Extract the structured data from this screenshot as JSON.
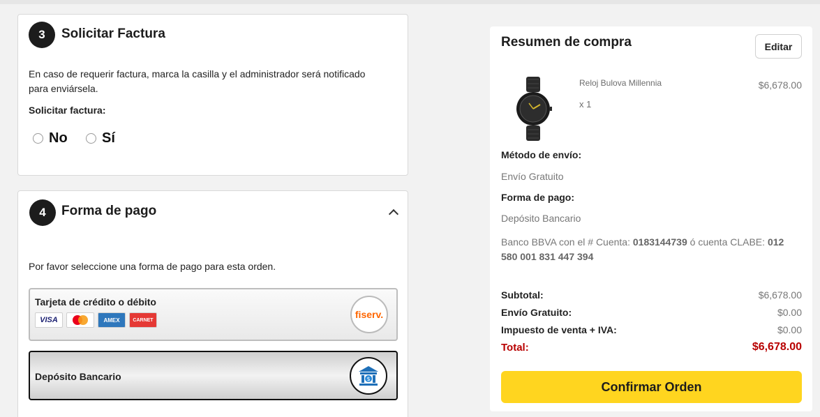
{
  "invoice": {
    "step": "3",
    "title": "Solicitar Factura",
    "description_line1": "En caso de requerir factura, marca la casilla y el administrador será notificado",
    "description_line2": "para enviársela.",
    "question": "Solicitar factura:",
    "options": [
      "No",
      "Sí"
    ]
  },
  "payment": {
    "step": "4",
    "title": "Forma de pago",
    "instruction": "Por favor seleccione una forma de pago para esta orden.",
    "card_option": {
      "title": "Tarjeta de crédito o débito",
      "brands": [
        "VISA",
        "MC",
        "AMEX",
        "CARNET"
      ],
      "provider_logo": "fiserv."
    },
    "bank_option": {
      "title": "Depósito Bancario",
      "icon": "bank-icon"
    }
  },
  "summary": {
    "title": "Resumen de compra",
    "edit_label": "Editar",
    "product": {
      "name": "Reloj Bulova Millennia",
      "qty": "x 1",
      "price": "$6,678.00"
    },
    "shipping_label": "Método de envío:",
    "shipping_value": "Envío Gratuito",
    "payment_label": "Forma de pago:",
    "payment_value": "Depósito Bancario",
    "bank_prefix": "Banco BBVA con el # Cuenta: ",
    "bank_account": "0183144739",
    "bank_middle": " ó cuenta CLABE: ",
    "bank_clabe_part1": "012",
    "bank_clabe_part2": "580 001 831 447 394",
    "rows": [
      {
        "label": "Subtotal:",
        "value": "$6,678.00"
      },
      {
        "label": "Envío Gratuito:",
        "value": "$0.00"
      },
      {
        "label": "Impuesto de venta + IVA:",
        "value": "$0.00"
      }
    ],
    "total_label": "Total:",
    "total_value": "$6,678.00",
    "confirm_label": "Confirmar Orden"
  },
  "colors": {
    "accent_yellow": "#ffd51f",
    "total_red": "#b80000",
    "step_badge": "#1c1c1c"
  }
}
